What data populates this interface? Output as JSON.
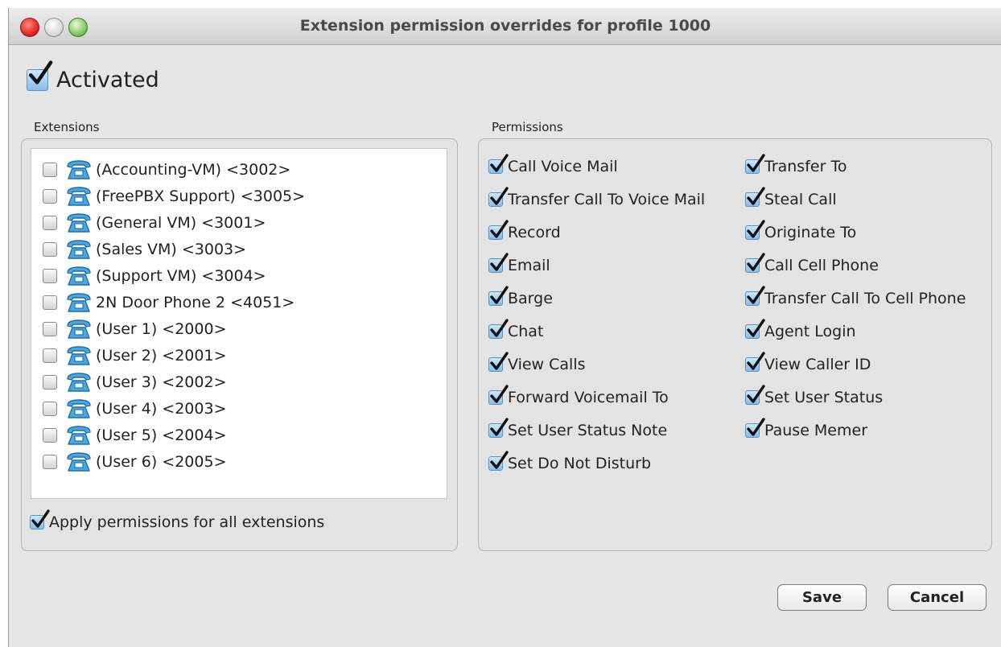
{
  "window": {
    "title": "Extension permission overrides for profile 1000"
  },
  "activated": {
    "label": "Activated",
    "checked": true
  },
  "extensions": {
    "group_label": "Extensions",
    "items": [
      {
        "label": "(Accounting-VM) <3002>",
        "checked": false
      },
      {
        "label": "(FreePBX Support) <3005>",
        "checked": false
      },
      {
        "label": "(General VM) <3001>",
        "checked": false
      },
      {
        "label": "(Sales VM) <3003>",
        "checked": false
      },
      {
        "label": "(Support VM) <3004>",
        "checked": false
      },
      {
        "label": "2N Door Phone 2 <4051>",
        "checked": false
      },
      {
        "label": "(User 1) <2000>",
        "checked": false
      },
      {
        "label": "(User 2) <2001>",
        "checked": false
      },
      {
        "label": "(User 3) <2002>",
        "checked": false
      },
      {
        "label": "(User 4) <2003>",
        "checked": false
      },
      {
        "label": "(User 5) <2004>",
        "checked": false
      },
      {
        "label": "(User 6) <2005>",
        "checked": false
      }
    ],
    "apply_all": {
      "label": "Apply permissions for all extensions",
      "checked": true
    }
  },
  "permissions": {
    "group_label": "Permissions",
    "left": [
      {
        "label": "Call Voice Mail",
        "checked": true
      },
      {
        "label": "Transfer Call To Voice Mail",
        "checked": true
      },
      {
        "label": "Record",
        "checked": true
      },
      {
        "label": "Email",
        "checked": true
      },
      {
        "label": "Barge",
        "checked": true
      },
      {
        "label": "Chat",
        "checked": true
      },
      {
        "label": "View Calls",
        "checked": true
      },
      {
        "label": "Forward Voicemail To",
        "checked": true
      },
      {
        "label": "Set User Status Note",
        "checked": true
      },
      {
        "label": "Set Do Not Disturb",
        "checked": true
      }
    ],
    "right": [
      {
        "label": "Transfer To",
        "checked": true
      },
      {
        "label": "Steal Call",
        "checked": true
      },
      {
        "label": "Originate To",
        "checked": true
      },
      {
        "label": "Call Cell Phone",
        "checked": true
      },
      {
        "label": "Transfer Call To Cell Phone",
        "checked": true
      },
      {
        "label": "Agent Login",
        "checked": true
      },
      {
        "label": "View Caller ID",
        "checked": true
      },
      {
        "label": "Set User Status",
        "checked": true
      },
      {
        "label": "Pause Memer",
        "checked": true
      }
    ]
  },
  "buttons": {
    "save": "Save",
    "cancel": "Cancel"
  },
  "icons": {
    "extension": "desk-phone-icon",
    "check": "checkmark-icon"
  },
  "colors": {
    "phone": "#3f9fd8",
    "check_fill": "#9cc9ef",
    "window_bg": "#e6e6e6"
  }
}
